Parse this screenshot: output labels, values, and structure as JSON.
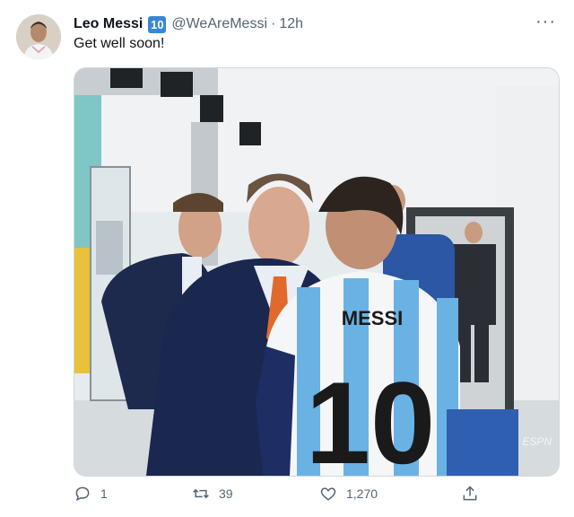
{
  "tweet": {
    "author_name": "Leo Messi",
    "author_badge": "10",
    "author_handle": "@WeAreMessi",
    "separator": "·",
    "time": "12h",
    "more_label": "···",
    "text": "Get well soon!",
    "media_jersey_name": "MESSI",
    "media_jersey_number": "10",
    "media_watermark": "ESPN",
    "actions": {
      "reply_count": "1",
      "retweet_count": "39",
      "like_count": "1,270"
    }
  },
  "icons": [
    "reply-icon",
    "retweet-icon",
    "like-icon",
    "share-icon"
  ],
  "colors": {
    "badge": "#3a86d6",
    "muted": "#536471"
  }
}
